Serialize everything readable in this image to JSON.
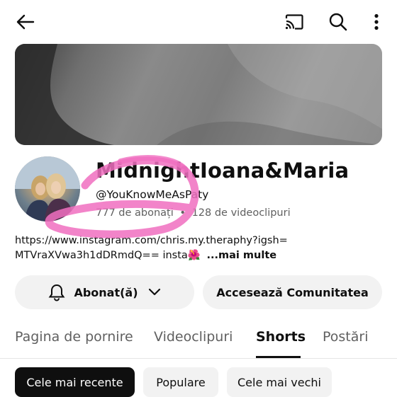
{
  "icons": {
    "back": "back-arrow-icon",
    "cast": "cast-icon",
    "search": "search-icon",
    "more": "more-vert-icon",
    "bell": "bell-icon",
    "chevron": "chevron-down-icon"
  },
  "channel": {
    "name": "MidnightIoana&Maria",
    "handle": "@YouKnowMeAsPaty",
    "subscribers": "777 de abonați",
    "separator": "•",
    "videos": "128 de videoclipuri",
    "description_line1": "https://www.instagram.com/chris.my.theraphy?igsh=",
    "description_line2": "MTVraXVwa3h1dDRmdQ== insta🌺",
    "more_label": "...mai multe"
  },
  "actions": {
    "subscribe_label": "Abonat(ă)",
    "community_label": "Accesează Comunitatea"
  },
  "tabs": [
    {
      "label": "Pagina de pornire",
      "active": false
    },
    {
      "label": "Videoclipuri",
      "active": false
    },
    {
      "label": "Shorts",
      "active": true
    },
    {
      "label": "Postări",
      "active": false
    }
  ],
  "chips": [
    {
      "label": "Cele mai recente",
      "selected": true
    },
    {
      "label": "Populare",
      "selected": false
    },
    {
      "label": "Cele mai vechi",
      "selected": false
    }
  ],
  "colors": {
    "accent_text": "#0f0f0f",
    "secondary_text": "#606060",
    "pill_bg": "#f2f2f2",
    "annotation_pink": "#f06fc0"
  }
}
